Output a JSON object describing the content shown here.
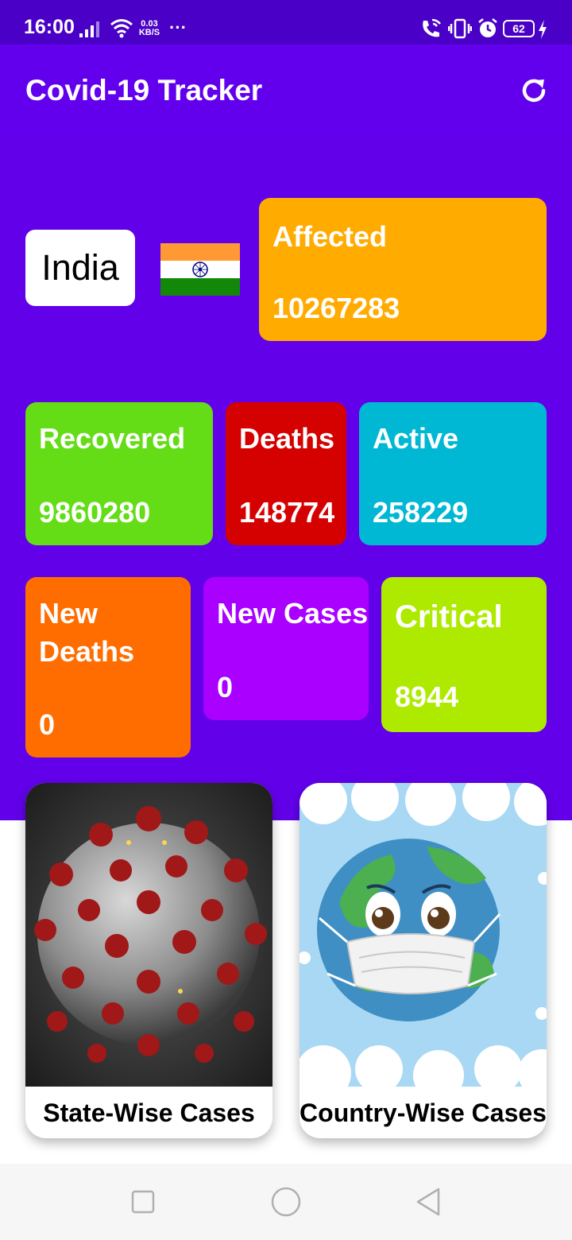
{
  "status_bar": {
    "time": "16:00",
    "net_speed_value": "0.03",
    "net_speed_unit": "KB/S",
    "more": "···",
    "battery": "62"
  },
  "app_bar": {
    "title": "Covid-19 Tracker",
    "refresh_icon": "refresh-icon"
  },
  "country": {
    "name": "India",
    "flag_icon": "india-flag-icon"
  },
  "stats": {
    "affected": {
      "label": "Affected",
      "value": "10267283",
      "color": "#ffab00"
    },
    "recovered": {
      "label": "Recovered",
      "value": "9860280",
      "color": "#64dd17"
    },
    "deaths": {
      "label": "Deaths",
      "value": "148774",
      "color": "#d50000"
    },
    "active": {
      "label": "Active",
      "value": "258229",
      "color": "#00b8d4"
    },
    "new_deaths": {
      "label": "New Deaths",
      "value": "0",
      "color": "#ff6d00"
    },
    "new_cases": {
      "label": "New Cases",
      "value": "0",
      "color": "#aa00ff"
    },
    "critical": {
      "label": "Critical",
      "value": "8944",
      "color": "#aeea00"
    }
  },
  "cards": {
    "state_wise": {
      "caption": "State-Wise Cases",
      "image": "coronavirus-image"
    },
    "country_wise": {
      "caption": "Country-Wise Cases",
      "image": "masked-earth-image"
    }
  },
  "colors": {
    "status_bar": "#4a00c6",
    "app_bar": "#6200ee",
    "background": "#6200ea"
  },
  "nav": {
    "recents_icon": "square-icon",
    "home_icon": "circle-icon",
    "back_icon": "triangle-back-icon"
  }
}
